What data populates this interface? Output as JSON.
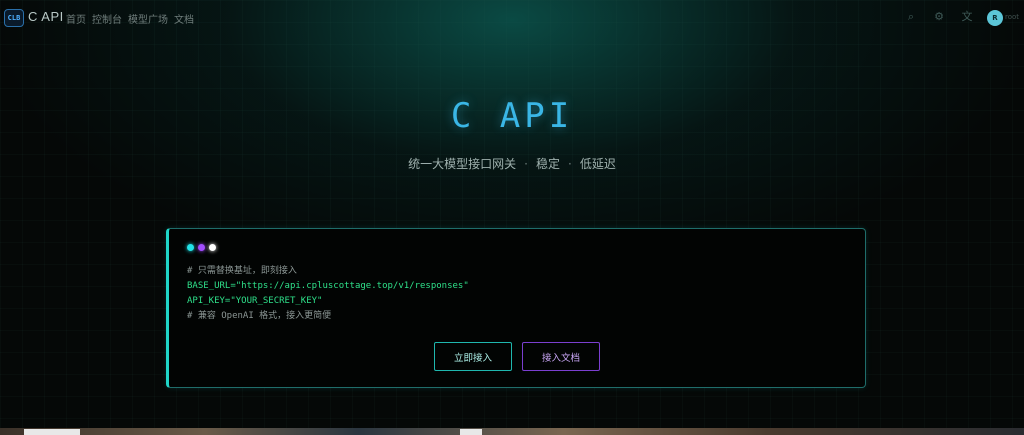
{
  "header": {
    "logo_text": "CLB",
    "brand": "C API",
    "nav": [
      "首页",
      "控制台",
      "模型广场",
      "文档"
    ],
    "icons": [
      "search-icon",
      "theme-icon",
      "language-icon"
    ],
    "avatar_initial": "R",
    "avatar_name": "root"
  },
  "hero": {
    "title": "C API",
    "subtitle_parts": [
      "统一大模型接口网关",
      "稳定",
      "低延迟"
    ],
    "separator": "·"
  },
  "terminal": {
    "dot_colors": [
      "#22e3e8",
      "#a24dff",
      "#ffffff"
    ],
    "lines": [
      {
        "type": "comment",
        "text": "# 只需替换基址，即刻接入"
      },
      {
        "type": "kv",
        "text": "BASE_URL=\"https://api.cpluscottage.top/v1/responses\""
      },
      {
        "type": "kv",
        "text": "API_KEY=\"YOUR_SECRET_KEY\""
      },
      {
        "type": "comment",
        "text": "# 兼容 OpenAI 格式，接入更简便"
      }
    ],
    "primary_button": "立即接入",
    "secondary_button": "接入文档"
  },
  "colors": {
    "accent_cyan": "#1fd6c8",
    "accent_purple": "#7b3fd0",
    "title_blue": "#3ab6e6",
    "code_green": "#2fe08a"
  }
}
